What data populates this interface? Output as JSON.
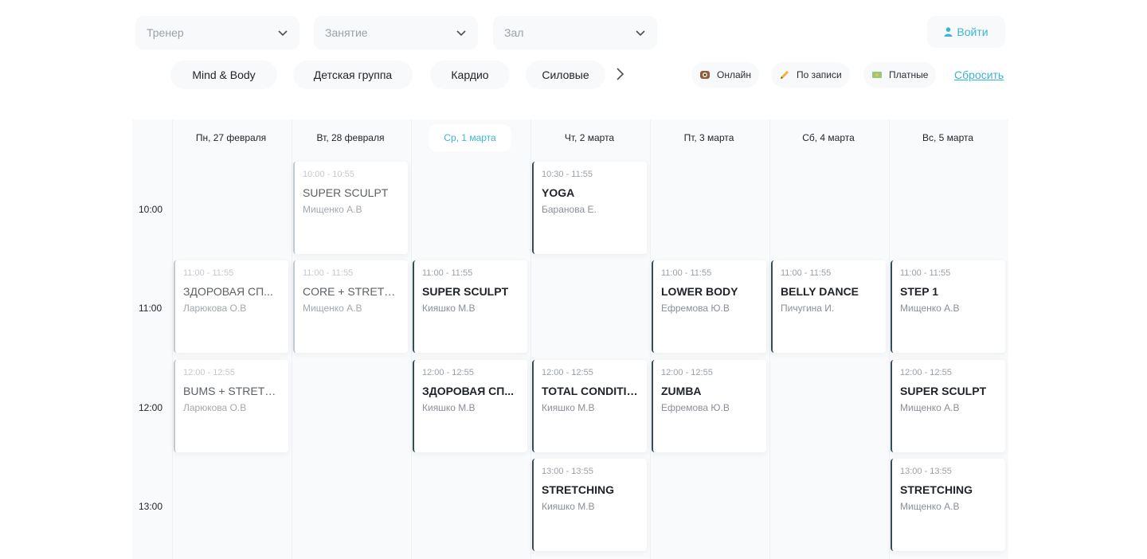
{
  "filters": {
    "trainer_placeholder": "Тренер",
    "activity_placeholder": "Занятие",
    "hall_placeholder": "Зал"
  },
  "login_label": "Войти",
  "categories": [
    "Mind & Body",
    "Детская группа",
    "Кардио",
    "Силовые"
  ],
  "flags": {
    "online": "Онлайн",
    "booking": "По записи",
    "paid": "Платные",
    "reset": "Сбросить"
  },
  "days": [
    "Пн, 27 февраля",
    "Вт, 28 февраля",
    "Ср, 1 марта",
    "Чт, 2 марта",
    "Пт, 3 марта",
    "Сб, 4 марта",
    "Вс, 5 марта"
  ],
  "active_day_index": 2,
  "times": [
    "10:00",
    "11:00",
    "12:00",
    "13:00"
  ],
  "classes": [
    {
      "day": 1,
      "slot": 0,
      "time": "10:00 - 10:55",
      "name": "SUPER SCULPT",
      "coach": "Мищенко А.В",
      "past": true
    },
    {
      "day": 3,
      "slot": 0,
      "time": "10:30 - 11:55",
      "name": "YOGA",
      "coach": "Баранова Е.",
      "past": false
    },
    {
      "day": 0,
      "slot": 1,
      "time": "11:00 - 11:55",
      "name": "ЗДОРОВАЯ СП...",
      "coach": "Ларюкова О.В",
      "past": true
    },
    {
      "day": 1,
      "slot": 1,
      "time": "11:00 - 11:55",
      "name": "CORE + STRETCH",
      "coach": "Мищенко А.В",
      "past": true
    },
    {
      "day": 2,
      "slot": 1,
      "time": "11:00 - 11:55",
      "name": "SUPER SCULPT",
      "coach": "Кияшко М.В",
      "past": false
    },
    {
      "day": 4,
      "slot": 1,
      "time": "11:00 - 11:55",
      "name": "LOWER BODY",
      "coach": "Ефремова Ю.В",
      "past": false
    },
    {
      "day": 5,
      "slot": 1,
      "time": "11:00 - 11:55",
      "name": "BELLY DANCE",
      "coach": "Пичугина И.",
      "past": false
    },
    {
      "day": 6,
      "slot": 1,
      "time": "11:00 - 11:55",
      "name": "STEP 1",
      "coach": "Мищенко А.В",
      "past": false
    },
    {
      "day": 0,
      "slot": 2,
      "time": "12:00 - 12:55",
      "name": "BUMS + STRETCH",
      "coach": "Ларюкова О.В",
      "past": true
    },
    {
      "day": 2,
      "slot": 2,
      "time": "12:00 - 12:55",
      "name": "ЗДОРОВАЯ СП...",
      "coach": "Кияшко М.В",
      "past": false
    },
    {
      "day": 3,
      "slot": 2,
      "time": "12:00 - 12:55",
      "name": "TOTAL CONDITION",
      "coach": "Кияшко М.В",
      "past": false
    },
    {
      "day": 4,
      "slot": 2,
      "time": "12:00 - 12:55",
      "name": "ZUMBA",
      "coach": "Ефремова Ю.В",
      "past": false
    },
    {
      "day": 6,
      "slot": 2,
      "time": "12:00 - 12:55",
      "name": "SUPER SCULPT",
      "coach": "Мищенко А.В",
      "past": false
    },
    {
      "day": 3,
      "slot": 3,
      "time": "13:00 - 13:55",
      "name": "STRETCHING",
      "coach": "Кияшко М.В",
      "past": false
    },
    {
      "day": 6,
      "slot": 3,
      "time": "13:00 - 13:55",
      "name": "STRETCHING",
      "coach": "Мищенко А.В",
      "past": false
    }
  ],
  "colors": {
    "accent": "#3bb4d6",
    "card_border": "#354c54",
    "background": "#f8fafc"
  }
}
